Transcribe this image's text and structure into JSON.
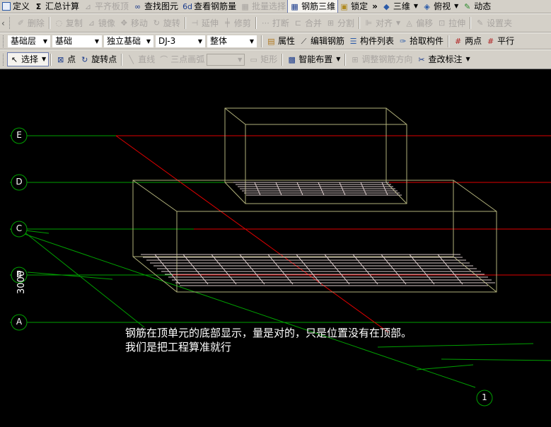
{
  "toolbar1": {
    "items": [
      {
        "label": "定义",
        "icon": "define-icon",
        "disabled": false
      },
      {
        "label": "汇总计算",
        "icon": "sigma-icon",
        "disabled": false
      },
      {
        "label": "平齐板顶",
        "icon": "align-slab-icon",
        "disabled": true
      },
      {
        "label": "查找图元",
        "icon": "binoculars-icon",
        "disabled": false
      },
      {
        "label": "查看钢筋量",
        "icon": "rebar-qty-icon",
        "disabled": false
      },
      {
        "label": "批量选择",
        "icon": "batch-select-icon",
        "disabled": true
      },
      {
        "label": "钢筋三维",
        "icon": "rebar-3d-icon",
        "disabled": false,
        "active": true
      },
      {
        "label": "锁定",
        "icon": "lock-icon",
        "disabled": false
      }
    ],
    "overflow": "»",
    "view_3d": "三维",
    "view_top": "俯视",
    "dynamic": "动态"
  },
  "toolbar2": {
    "items": [
      {
        "label": "删除",
        "icon": "delete-icon"
      },
      {
        "label": "复制",
        "icon": "copy-icon"
      },
      {
        "label": "镜像",
        "icon": "mirror-icon"
      },
      {
        "label": "移动",
        "icon": "move-icon"
      },
      {
        "label": "旋转",
        "icon": "rotate-icon"
      },
      {
        "label": "延伸",
        "icon": "extend-icon"
      },
      {
        "label": "修剪",
        "icon": "trim-icon"
      },
      {
        "label": "打断",
        "icon": "break-icon"
      },
      {
        "label": "合并",
        "icon": "merge-icon"
      },
      {
        "label": "分割",
        "icon": "split-icon"
      },
      {
        "label": "对齐",
        "icon": "align-icon"
      },
      {
        "label": "偏移",
        "icon": "offset-icon"
      },
      {
        "label": "拉伸",
        "icon": "stretch-icon"
      },
      {
        "label": "设置夹",
        "icon": "set-grip-icon"
      }
    ]
  },
  "toolbar3": {
    "layer": "基础层",
    "category": "基础",
    "type": "独立基础",
    "element": "DJ-3",
    "unit": "整体",
    "properties": "属性",
    "edit_rebar": "编辑钢筋",
    "component_list": "构件列表",
    "pick_component": "拾取构件",
    "two_points": "两点",
    "parallel": "平行"
  },
  "toolbar4": {
    "select": "选择",
    "point": "点",
    "rotate_point": "旋转点",
    "line": "直线",
    "arc": "三点画弧",
    "rect": "矩形",
    "smart_layout": "智能布置",
    "adjust_rebar": "调整钢筋方向",
    "check_mark": "查改标注"
  },
  "canvas": {
    "axes": [
      "E",
      "D",
      "C",
      "B",
      "A"
    ],
    "column_axis": "1",
    "dimension": "3000",
    "note_line1": "钢筋在顶单元的底部显示，量是对的，只是位置没有在顶部。",
    "note_line2": "我们是把工程算准就行",
    "colors": {
      "grid_green": "#00a000",
      "grid_red": "#e00000",
      "box": "#b0b07a",
      "rebar": "#d8c8c8"
    }
  }
}
